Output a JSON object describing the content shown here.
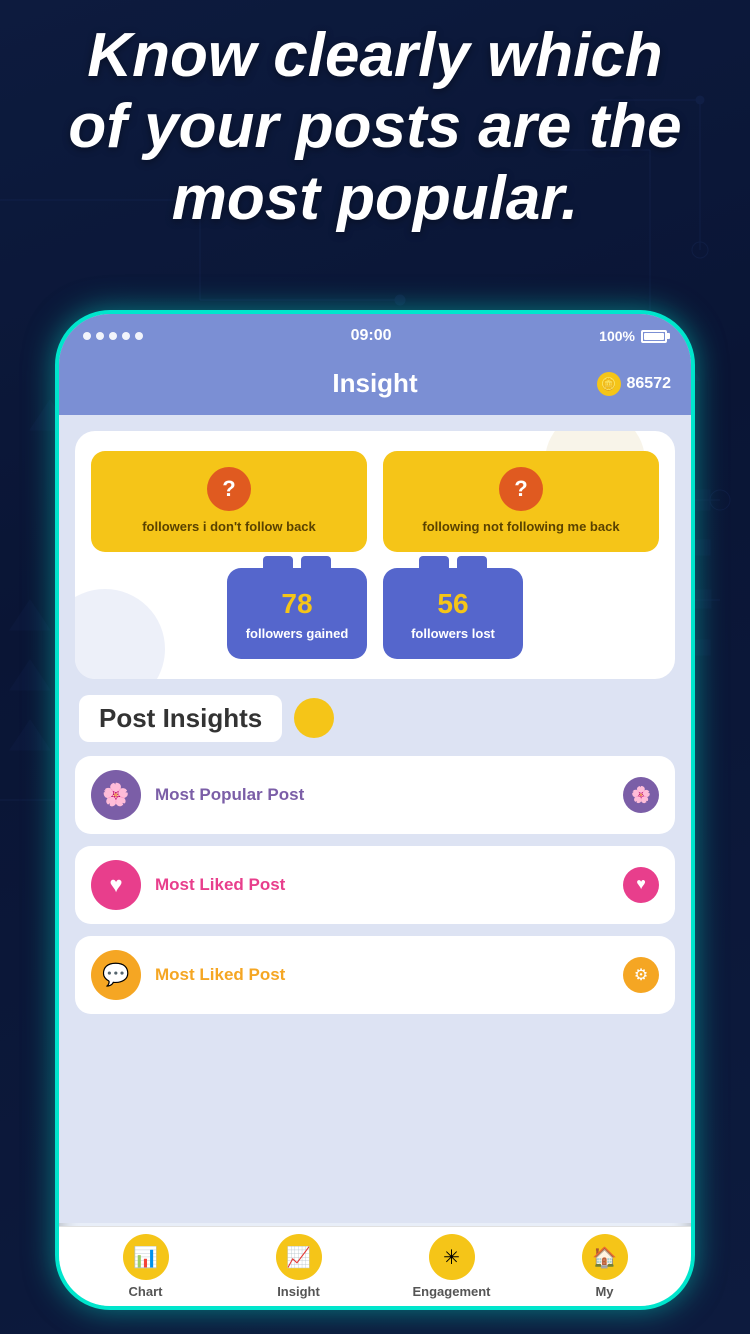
{
  "headline": {
    "line1": "Know clearly which",
    "line2": "of your posts are the",
    "line3": "most popular."
  },
  "status_bar": {
    "dots": 5,
    "time": "09:00",
    "battery_percent": "100%"
  },
  "app_header": {
    "title": "Insight",
    "coin_amount": "86572"
  },
  "stats": {
    "card1_label": "followers i don't follow back",
    "card2_label": "following not following me back",
    "followers_gained_number": "78",
    "followers_gained_label": "followers gained",
    "followers_lost_number": "56",
    "followers_lost_label": "followers lost"
  },
  "post_insights": {
    "section_title": "Post Insights",
    "rows": [
      {
        "label": "Most Popular Post",
        "color": "purple",
        "icon": "🌸",
        "right_icon": "🌸"
      },
      {
        "label": "Most Liked Post",
        "color": "pink",
        "icon": "♥",
        "right_icon": "♥"
      },
      {
        "label": "Most Liked Post",
        "color": "yellow",
        "icon": "💬",
        "right_icon": "⚙"
      }
    ]
  },
  "bottom_nav": {
    "items": [
      {
        "label": "Chart",
        "icon": "📊"
      },
      {
        "label": "Insight",
        "icon": "📈"
      },
      {
        "label": "Engagement",
        "icon": "✳"
      },
      {
        "label": "My",
        "icon": "🏠"
      }
    ]
  }
}
